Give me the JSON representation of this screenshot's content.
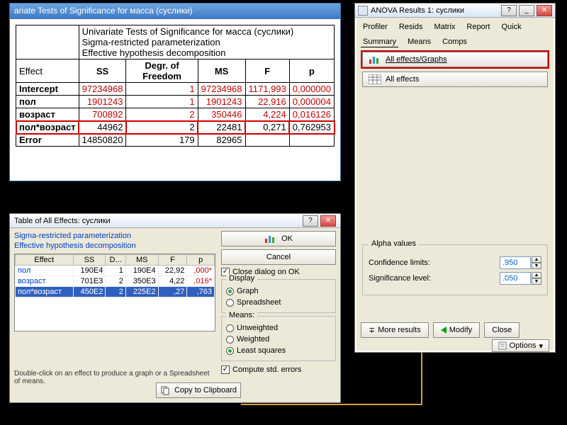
{
  "accent_color": "#d8a038",
  "top": {
    "titlebar": "ariate Tests of Significance for масса (суслики)",
    "desc1": "Univariate Tests of Significance for масса (суслики)",
    "desc2": "Sigma-restricted parameterization",
    "desc3": "Effective hypothesis decomposition",
    "headers": {
      "effect": "Effect",
      "ss": "SS",
      "df": "Degr. of Freedom",
      "ms": "MS",
      "f": "F",
      "p": "p"
    },
    "rows": [
      {
        "effect": "Intercept",
        "ss": "97234968",
        "df": "1",
        "ms": "97234968",
        "f": "1171,993",
        "p": "0,000000",
        "red": true
      },
      {
        "effect": "пол",
        "ss": "1901243",
        "df": "1",
        "ms": "1901243",
        "f": "22,916",
        "p": "0,000004",
        "red": true
      },
      {
        "effect": "возраст",
        "ss": "700892",
        "df": "2",
        "ms": "350446",
        "f": "4,224",
        "p": "0,016126",
        "red": true
      },
      {
        "effect": "пол*возраст",
        "ss": "44962",
        "df": "2",
        "ms": "22481",
        "f": "0,271",
        "p": "0,762953",
        "red": false,
        "highlight": true
      },
      {
        "effect": "Error",
        "ss": "14850820",
        "df": "179",
        "ms": "82965",
        "f": "",
        "p": "",
        "red": false
      }
    ]
  },
  "chart_data": {
    "type": "table",
    "title": "Univariate Tests of Significance for масса (суслики)",
    "columns": [
      "Effect",
      "SS",
      "Degr. of Freedom",
      "MS",
      "F",
      "p"
    ],
    "rows": [
      [
        "Intercept",
        97234968,
        1,
        97234968,
        1171.993,
        0.0
      ],
      [
        "пол",
        1901243,
        1,
        1901243,
        22.916,
        4e-06
      ],
      [
        "возраст",
        700892,
        2,
        350446,
        4.224,
        0.016126
      ],
      [
        "пол*возраст",
        44962,
        2,
        22481,
        0.271,
        0.762953
      ],
      [
        "Error",
        14850820,
        179,
        82965,
        null,
        null
      ]
    ]
  },
  "right": {
    "title": "ANOVA Results 1: суслики",
    "tabs": [
      "Profiler",
      "Resids",
      "Matrix",
      "Report",
      "Quick",
      "Summary",
      "Means",
      "Comps"
    ],
    "active_tab": "Summary",
    "btn_graphs": "All effects/Graphs",
    "btn_effects": "All effects",
    "alpha": {
      "legend": "Alpha values",
      "conf_label": "Confidence limits:",
      "conf_value": ".950",
      "sig_label": "Significance level:",
      "sig_value": ".050"
    },
    "more": "More results",
    "modify": "Modify",
    "close": "Close",
    "options": "Options"
  },
  "bottom": {
    "title": "Table of All Effects: суслики",
    "line1": "Sigma-restricted parameterization",
    "line2": "Effective hypothesis decomposition",
    "headers": {
      "effect": "Effect",
      "ss": "SS",
      "df": "D...",
      "ms": "MS",
      "f": "F",
      "p": "p"
    },
    "rows": [
      {
        "effect": "пол",
        "ss": "190E4",
        "df": "1",
        "ms": "190E4",
        "f": "22,92",
        "p": ",000*",
        "sel": false,
        "sig": true
      },
      {
        "effect": "возраст",
        "ss": "701E3",
        "df": "2",
        "ms": "350E3",
        "f": "4,22",
        "p": ",016*",
        "sel": false,
        "sig": true
      },
      {
        "effect": "пол*возраст",
        "ss": "450E2",
        "df": "2",
        "ms": "225E2",
        "f": ",27",
        "p": ",763",
        "sel": true,
        "sig": false
      }
    ],
    "ok": "OK",
    "cancel": "Cancel",
    "close_dialog": "Close dialog on OK",
    "display_legend": "Display",
    "display_graph": "Graph",
    "display_sheet": "Spreadsheet",
    "means_legend": "Means:",
    "means_unw": "Unweighted",
    "means_w": "Weighted",
    "means_ls": "Least squares",
    "compute": "Compute std. errors",
    "foot": "Double-click on an effect to produce a graph or a Spreadsheet of means.",
    "copy": "Copy to Clipboard"
  }
}
